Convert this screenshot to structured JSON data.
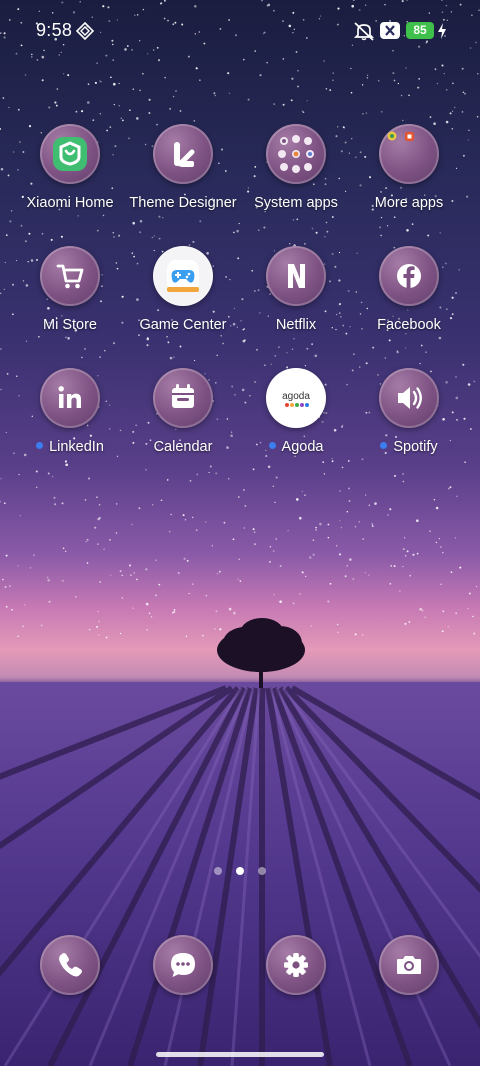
{
  "status_bar": {
    "time": "9:58",
    "battery_level": "85",
    "icons": [
      "nfc-icon",
      "silent-mode-icon",
      "no-sim-icon",
      "charging-icon"
    ]
  },
  "home_grid": [
    {
      "label": "Xiaomi Home",
      "icon": "xiaomi-home-icon",
      "notification_dot": false
    },
    {
      "label": "Theme Designer",
      "icon": "theme-designer-icon",
      "notification_dot": false
    },
    {
      "label": "System apps",
      "icon": "folder-icon",
      "notification_dot": false
    },
    {
      "label": "More apps",
      "icon": "folder-icon",
      "notification_dot": false
    },
    {
      "label": "Mi Store",
      "icon": "shopping-cart-icon",
      "notification_dot": false
    },
    {
      "label": "Game Center",
      "icon": "gamepad-icon",
      "notification_dot": false
    },
    {
      "label": "Netflix",
      "icon": "netflix-icon",
      "notification_dot": false
    },
    {
      "label": "Facebook",
      "icon": "facebook-icon",
      "notification_dot": false
    },
    {
      "label": "LinkedIn",
      "icon": "linkedin-icon",
      "notification_dot": true
    },
    {
      "label": "Calendar",
      "icon": "calendar-icon",
      "notification_dot": false
    },
    {
      "label": "Agoda",
      "icon": "agoda-icon",
      "notification_dot": true
    },
    {
      "label": "Spotify",
      "icon": "speaker-icon",
      "notification_dot": true
    }
  ],
  "agoda_logo_text": "agoda",
  "page_indicator": {
    "pages": 3,
    "active": 2
  },
  "dock": [
    {
      "name": "Phone",
      "icon": "phone-icon"
    },
    {
      "name": "Messages",
      "icon": "message-icon"
    },
    {
      "name": "Settings",
      "icon": "gear-icon"
    },
    {
      "name": "Camera",
      "icon": "camera-icon"
    }
  ],
  "colors": {
    "icon_bg": "#7d5283",
    "notification_dot": "#3c7df0",
    "battery": "#3ec04b",
    "xiaomi_home_green": "#3fbe72"
  }
}
